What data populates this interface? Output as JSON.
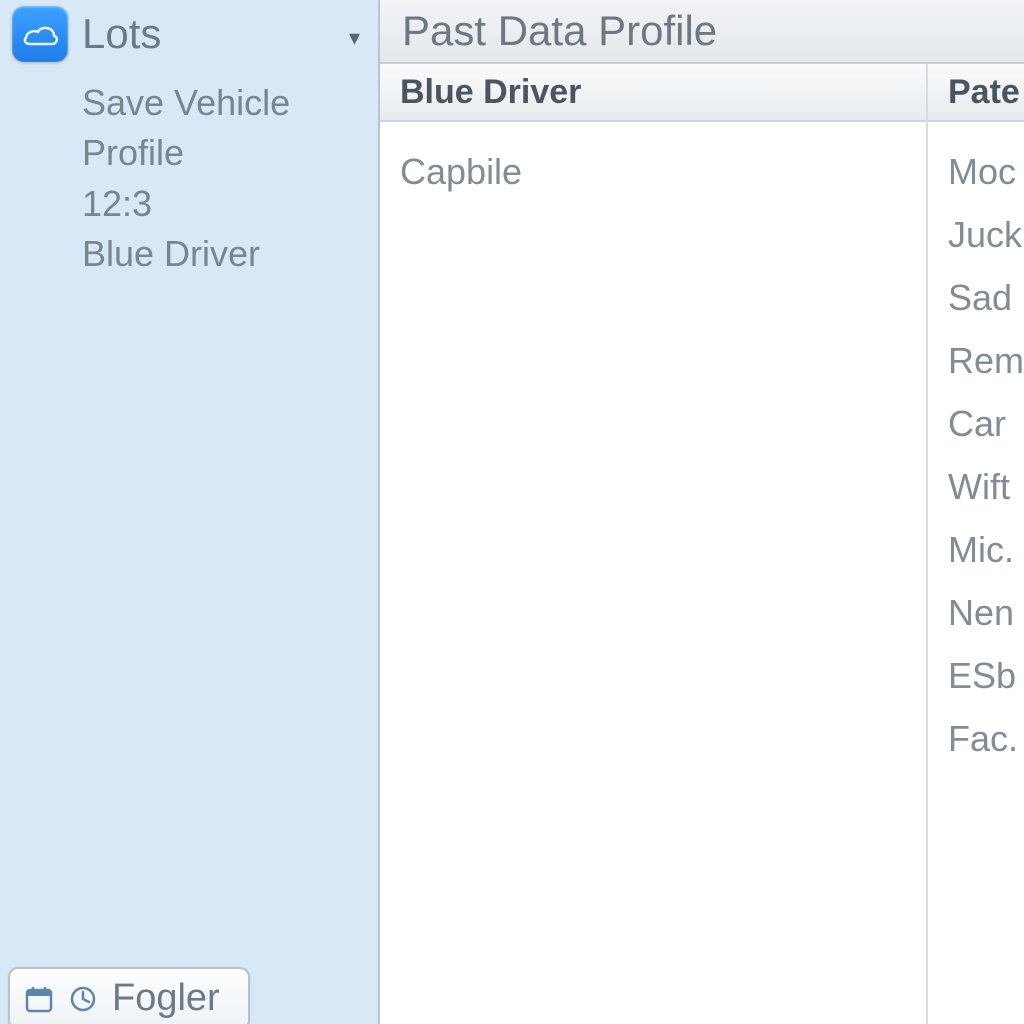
{
  "sidebar": {
    "title": "Lots",
    "items": [
      "Save Vehicle",
      "Profile",
      "12:3",
      "Blue Driver"
    ],
    "bottom_button": "Fogler"
  },
  "main": {
    "title": "Past Data Profile",
    "columns": [
      {
        "header": "Blue Driver",
        "rows": [
          "Capbile"
        ]
      },
      {
        "header": "Pate",
        "rows": [
          "Moc",
          "Juck",
          "Sad",
          "Rem",
          "Car",
          "Wift",
          "Mic.",
          "Nen",
          "ESb",
          "Fac."
        ]
      }
    ]
  }
}
